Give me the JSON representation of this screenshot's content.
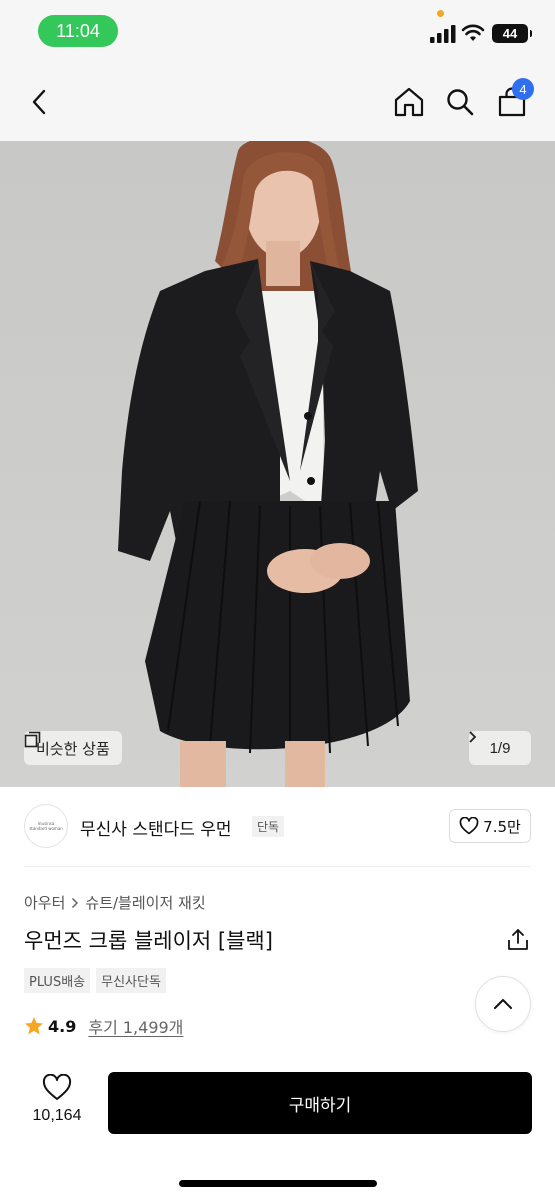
{
  "status_bar": {
    "time": "11:04",
    "battery": "44"
  },
  "nav": {
    "cart_count": "4",
    "icons": [
      "back-chevron-icon",
      "home-icon",
      "search-icon",
      "cart-icon"
    ]
  },
  "hero": {
    "similar_label": "비슷한 상품",
    "pager": "1/9"
  },
  "brand": {
    "logo_text": "musinsa standard woman",
    "name": "무신사 스탠다드 우먼",
    "tag": "단독",
    "likes": "7.5만"
  },
  "product": {
    "breadcrumb": [
      "아우터",
      "슈트/블레이저 재킷"
    ],
    "title": "우먼즈 크롭 블레이저 [블랙]",
    "tags": [
      "PLUS배송",
      "무신사단독"
    ],
    "rating": "4.9",
    "reviews": "후기 1,499개"
  },
  "bottom": {
    "wish_count": "10,164",
    "buy_label": "구매하기"
  },
  "colors": {
    "status_pill": "#34c759",
    "badge": "#2f6ff0",
    "star": "#f5a623",
    "buy": "#000000"
  }
}
